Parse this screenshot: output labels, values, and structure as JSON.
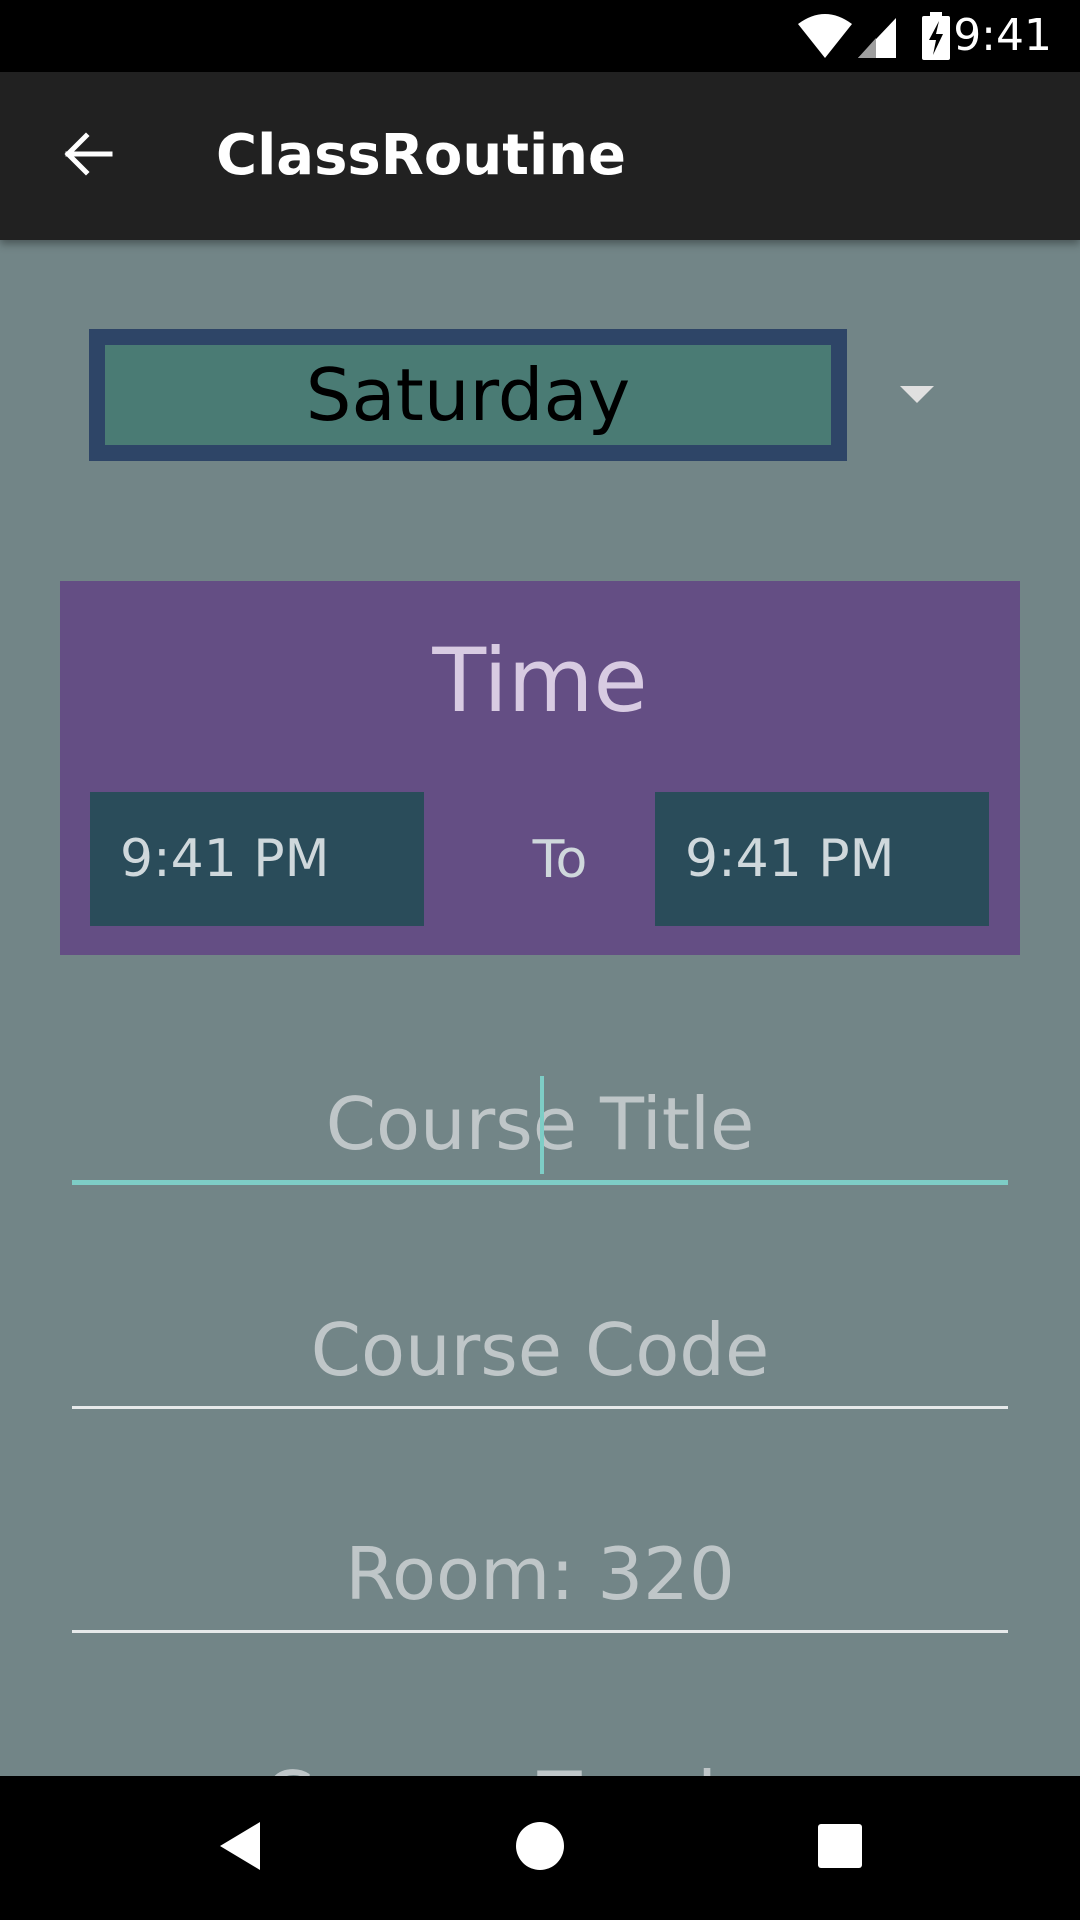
{
  "status_bar": {
    "time": "9:41",
    "icons": [
      "wifi-icon",
      "signal-icon",
      "battery-charging-icon"
    ]
  },
  "app_bar": {
    "title": "ClassRoutine",
    "back_icon": "arrow-back-icon"
  },
  "day_spinner": {
    "selected": "Saturday",
    "arrow_icon": "dropdown-arrow-icon"
  },
  "time_section": {
    "heading": "Time",
    "start_time": "9:41 PM",
    "separator": "To",
    "end_time": "9:41 PM"
  },
  "fields": {
    "course_title_placeholder": "Course Title",
    "course_code_placeholder": "Course Code",
    "room_placeholder": "Room: 320",
    "course_teacher_placeholder": "Course Teacher"
  },
  "nav_bar": {
    "icons": [
      "back-triangle-icon",
      "home-circle-icon",
      "recents-square-icon"
    ]
  },
  "colors": {
    "background": "#728587",
    "app_bar": "#212121",
    "spinner_border": "#2e4567",
    "spinner_fill": "#4a7b74",
    "time_panel": "#644e84",
    "time_box": "#2a4c5a",
    "accent": "#7ecdc6"
  }
}
